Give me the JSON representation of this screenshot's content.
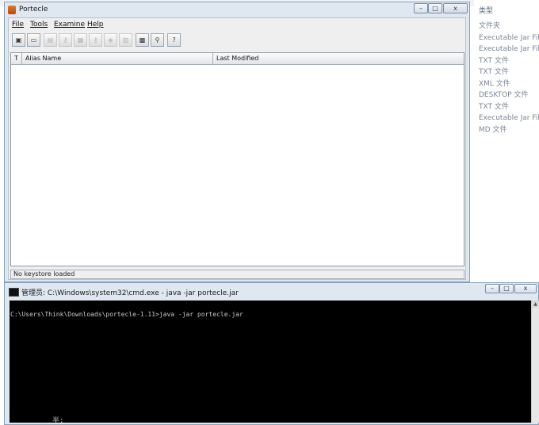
{
  "background": {
    "header": "类型",
    "types": [
      "文件夹",
      "Executable Jar File",
      "Executable Jar File",
      "TXT 文件",
      "TXT 文件",
      "XML 文件",
      "DESKTOP 文件",
      "TXT 文件",
      "Executable Jar File",
      "MD 文件"
    ]
  },
  "portecle": {
    "title": "Portecle",
    "controls": {
      "min": "–",
      "max": "□",
      "close": "x"
    },
    "menu": {
      "file": "File",
      "tools": "Tools",
      "examine": "Examine",
      "help": "Help"
    },
    "toolbar": {
      "new_icon": "new-keystore-icon",
      "open_icon": "open-keystore-icon",
      "save_icon": "save-keystore-icon",
      "genkey_icon": "generate-key-pair-icon",
      "import_icon": "import-certificate-icon",
      "import_keypair_icon": "import-key-pair-icon",
      "keystore_report_icon": "keystore-report-icon",
      "properties_icon": "keystore-properties-icon",
      "examine_cert_icon": "examine-certificate-icon",
      "examine_ssl_icon": "examine-ssl-icon",
      "help_icon": "help-icon",
      "glyphs": {
        "new": "▣",
        "open": "▭",
        "save": "▤",
        "genkey": "⚷",
        "import": "▦",
        "importkp": "⚷",
        "report": "◈",
        "props": "▥",
        "exam": "▩",
        "ssl": "⚲",
        "help": "?"
      }
    },
    "table": {
      "col_alias": "Alias Name",
      "col_modified": "Last Modified",
      "type_icon": "T"
    },
    "status": "No keystore loaded"
  },
  "cmd": {
    "title": "管理员: C:\\Windows\\system32\\cmd.exe - java  -jar portecle.jar",
    "prompt": "C:\\Users\\Think\\Downloads\\portecle-1.11>java -jar portecle.jar",
    "ime": "半:",
    "controls": {
      "min": "–",
      "max": "□",
      "close": "x"
    },
    "scroll_up": "▲"
  }
}
